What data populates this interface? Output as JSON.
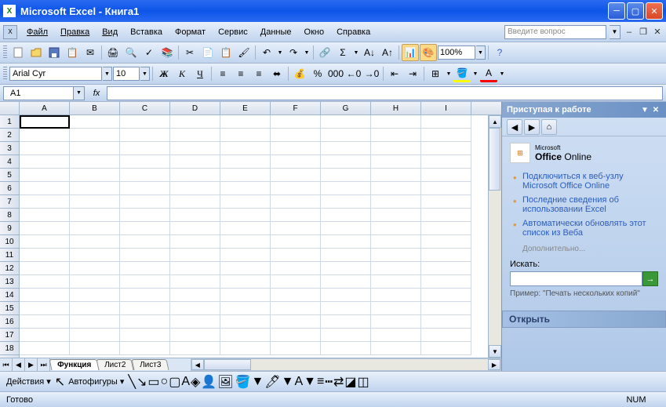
{
  "titlebar": {
    "app": "Microsoft Excel",
    "doc": "Книга1"
  },
  "menu": {
    "file": "Файл",
    "edit": "Правка",
    "view": "Вид",
    "insert": "Вставка",
    "format": "Формат",
    "tools": "Сервис",
    "data": "Данные",
    "window": "Окно",
    "help": "Справка",
    "helpbox": "Введите вопрос"
  },
  "toolbar": {
    "zoom": "100%"
  },
  "format": {
    "font": "Arial Cyr",
    "size": "10"
  },
  "namebox": "A1",
  "columns": [
    "A",
    "B",
    "C",
    "D",
    "E",
    "F",
    "G",
    "H",
    "I"
  ],
  "rows": [
    "1",
    "2",
    "3",
    "4",
    "5",
    "6",
    "7",
    "8",
    "9",
    "10",
    "11",
    "12",
    "13",
    "14",
    "15",
    "16",
    "17",
    "18"
  ],
  "sheets": {
    "active": "Функция",
    "s2": "Лист2",
    "s3": "Лист3"
  },
  "taskpane": {
    "title": "Приступая к работе",
    "logo_ms": "Microsoft",
    "logo_office": "Office",
    "logo_online": "Online",
    "link1": "Подключиться к веб-узлу Microsoft Office Online",
    "link2": "Последние сведения об использовании Excel",
    "link3": "Автоматически обновлять этот список из Веба",
    "more": "Дополнительно...",
    "search_label": "Искать:",
    "example": "Пример: \"Печать нескольких копий\"",
    "open": "Открыть"
  },
  "drawbar": {
    "actions": "Действия",
    "autoshapes": "Автофигуры"
  },
  "status": {
    "ready": "Готово",
    "num": "NUM"
  }
}
